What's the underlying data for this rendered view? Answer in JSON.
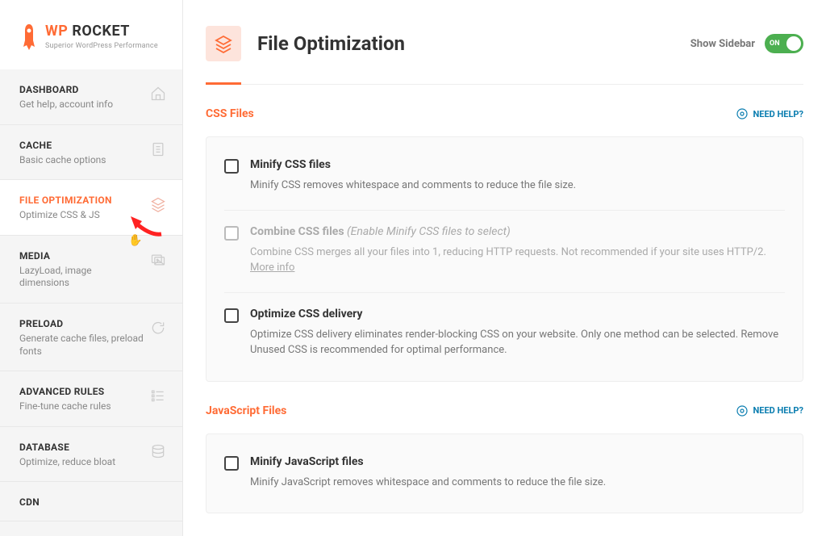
{
  "logo": {
    "wp": "WP",
    "rocket": " ROCKET",
    "tagline": "Superior WordPress Performance"
  },
  "nav": [
    {
      "label": "DASHBOARD",
      "desc": "Get help, account info",
      "icon": "home"
    },
    {
      "label": "CACHE",
      "desc": "Basic cache options",
      "icon": "file"
    },
    {
      "label": "FILE OPTIMIZATION",
      "desc": "Optimize CSS & JS",
      "icon": "stack",
      "active": true
    },
    {
      "label": "MEDIA",
      "desc": "LazyLoad, image dimensions",
      "icon": "image"
    },
    {
      "label": "PRELOAD",
      "desc": "Generate cache files, preload fonts",
      "icon": "refresh"
    },
    {
      "label": "ADVANCED RULES",
      "desc": "Fine-tune cache rules",
      "icon": "list"
    },
    {
      "label": "DATABASE",
      "desc": "Optimize, reduce bloat",
      "icon": "database"
    },
    {
      "label": "CDN",
      "desc": "",
      "icon": ""
    }
  ],
  "page": {
    "title": "File Optimization",
    "show_sidebar": "Show Sidebar",
    "toggle_on": "ON"
  },
  "sections": [
    {
      "title": "CSS Files",
      "help": "NEED HELP?",
      "options": [
        {
          "title": "Minify CSS files",
          "desc": "Minify CSS removes whitespace and comments to reduce the file size."
        },
        {
          "title": "Combine CSS files ",
          "note": "(Enable Minify CSS files to select)",
          "desc": "Combine CSS merges all your files into 1, reducing HTTP requests. Not recommended if your site uses HTTP/2. ",
          "link": "More info",
          "disabled": true
        },
        {
          "title": "Optimize CSS delivery",
          "desc": "Optimize CSS delivery eliminates render-blocking CSS on your website. Only one method can be selected. Remove Unused CSS is recommended for optimal performance."
        }
      ]
    },
    {
      "title": "JavaScript Files",
      "help": "NEED HELP?",
      "options": [
        {
          "title": "Minify JavaScript files",
          "desc": "Minify JavaScript removes whitespace and comments to reduce the file size."
        }
      ]
    }
  ]
}
